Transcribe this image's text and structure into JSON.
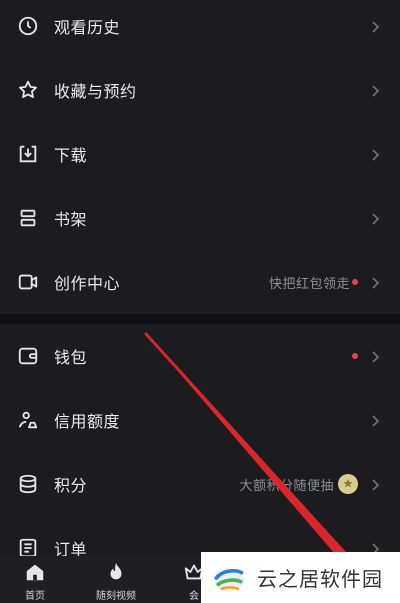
{
  "menu": {
    "items": [
      {
        "label": "观看历史",
        "icon": "clock-icon"
      },
      {
        "label": "收藏与预约",
        "icon": "star-icon"
      },
      {
        "label": "下载",
        "icon": "download-icon"
      },
      {
        "label": "书架",
        "icon": "bookshelf-icon"
      },
      {
        "label": "创作中心",
        "icon": "video-camera-icon",
        "hint": "快把红包领走",
        "dot": true
      }
    ],
    "items2": [
      {
        "label": "钱包",
        "icon": "wallet-icon",
        "dot": true
      },
      {
        "label": "信用额度",
        "icon": "credit-icon"
      },
      {
        "label": "积分",
        "icon": "points-icon",
        "hint": "大额积分随便抽"
      },
      {
        "label": "订单",
        "icon": "order-icon"
      }
    ]
  },
  "tabbar": {
    "tabs": [
      {
        "label": "首页",
        "icon": "home-icon"
      },
      {
        "label": "随刻视频",
        "icon": "flame-icon"
      },
      {
        "label": "会",
        "icon": "crown-icon"
      }
    ]
  },
  "watermark": {
    "text": "云之居软件园"
  },
  "colors": {
    "background": "#1b1b20",
    "dot": "#e5405a",
    "hint": "#8e8e96"
  }
}
